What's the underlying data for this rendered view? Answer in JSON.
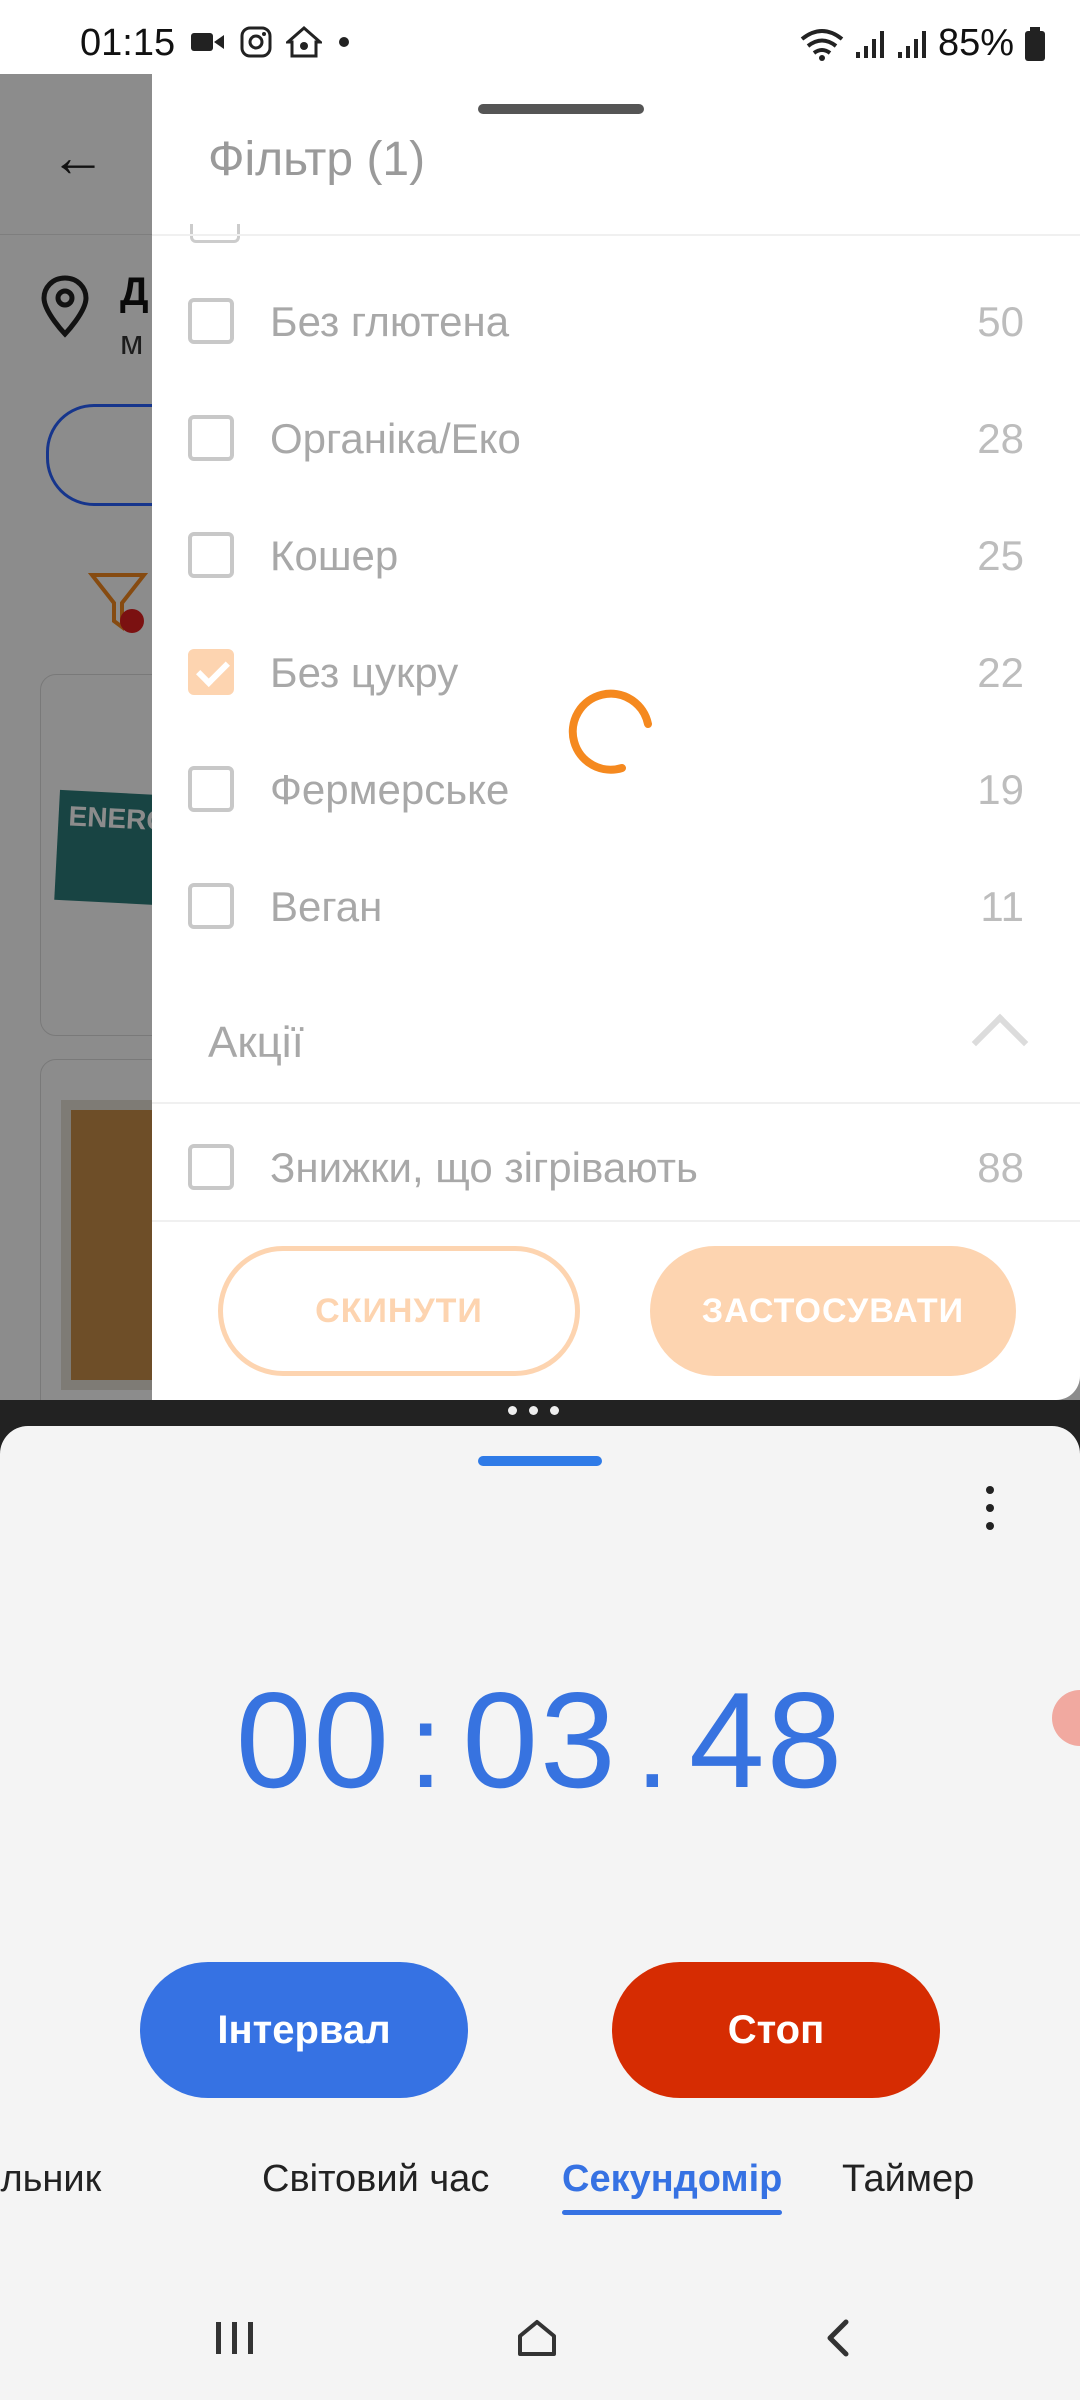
{
  "status_bar": {
    "time": "01:15",
    "battery": "85%",
    "icons": [
      "video-camera-icon",
      "instagram-icon",
      "home-app-icon",
      "dot-icon",
      "wifi-icon",
      "signal-icon",
      "signal-icon",
      "battery-icon"
    ]
  },
  "background_app": {
    "location_initial": "Д",
    "location_sub": "м"
  },
  "filter_sheet": {
    "title": "Фільтр (1)",
    "options": [
      {
        "label": "Без глютена",
        "count": "50",
        "checked": false
      },
      {
        "label": "Органіка/Еко",
        "count": "28",
        "checked": false
      },
      {
        "label": "Кошер",
        "count": "25",
        "checked": false
      },
      {
        "label": "Без цукру",
        "count": "22",
        "checked": true
      },
      {
        "label": "Фермерське",
        "count": "19",
        "checked": false
      },
      {
        "label": "Веган",
        "count": "11",
        "checked": false
      }
    ],
    "section_title": "Акції",
    "section_option": {
      "label": "Знижки, що зігрівають",
      "count": "88",
      "checked": false
    },
    "reset_label": "СКИНУТИ",
    "apply_label": "ЗАСТОСУВАТИ",
    "accent_color": "#fdd4b0",
    "spinner_color": "#f5891f"
  },
  "stopwatch": {
    "minutes": "00",
    "seconds": "03",
    "hundredths": "48",
    "sep1": ":",
    "sep2": ".",
    "lap_label": "Інтервал",
    "stop_label": "Стоп",
    "tabs": [
      "ільник",
      "Світовий час",
      "Секундомір",
      "Таймер"
    ],
    "active_tab": "Секундомір",
    "time_color": "#3773e0",
    "stop_color": "#d62c02"
  },
  "nav_bar": {
    "items": [
      "recent-apps-icon",
      "home-icon",
      "back-icon"
    ]
  }
}
